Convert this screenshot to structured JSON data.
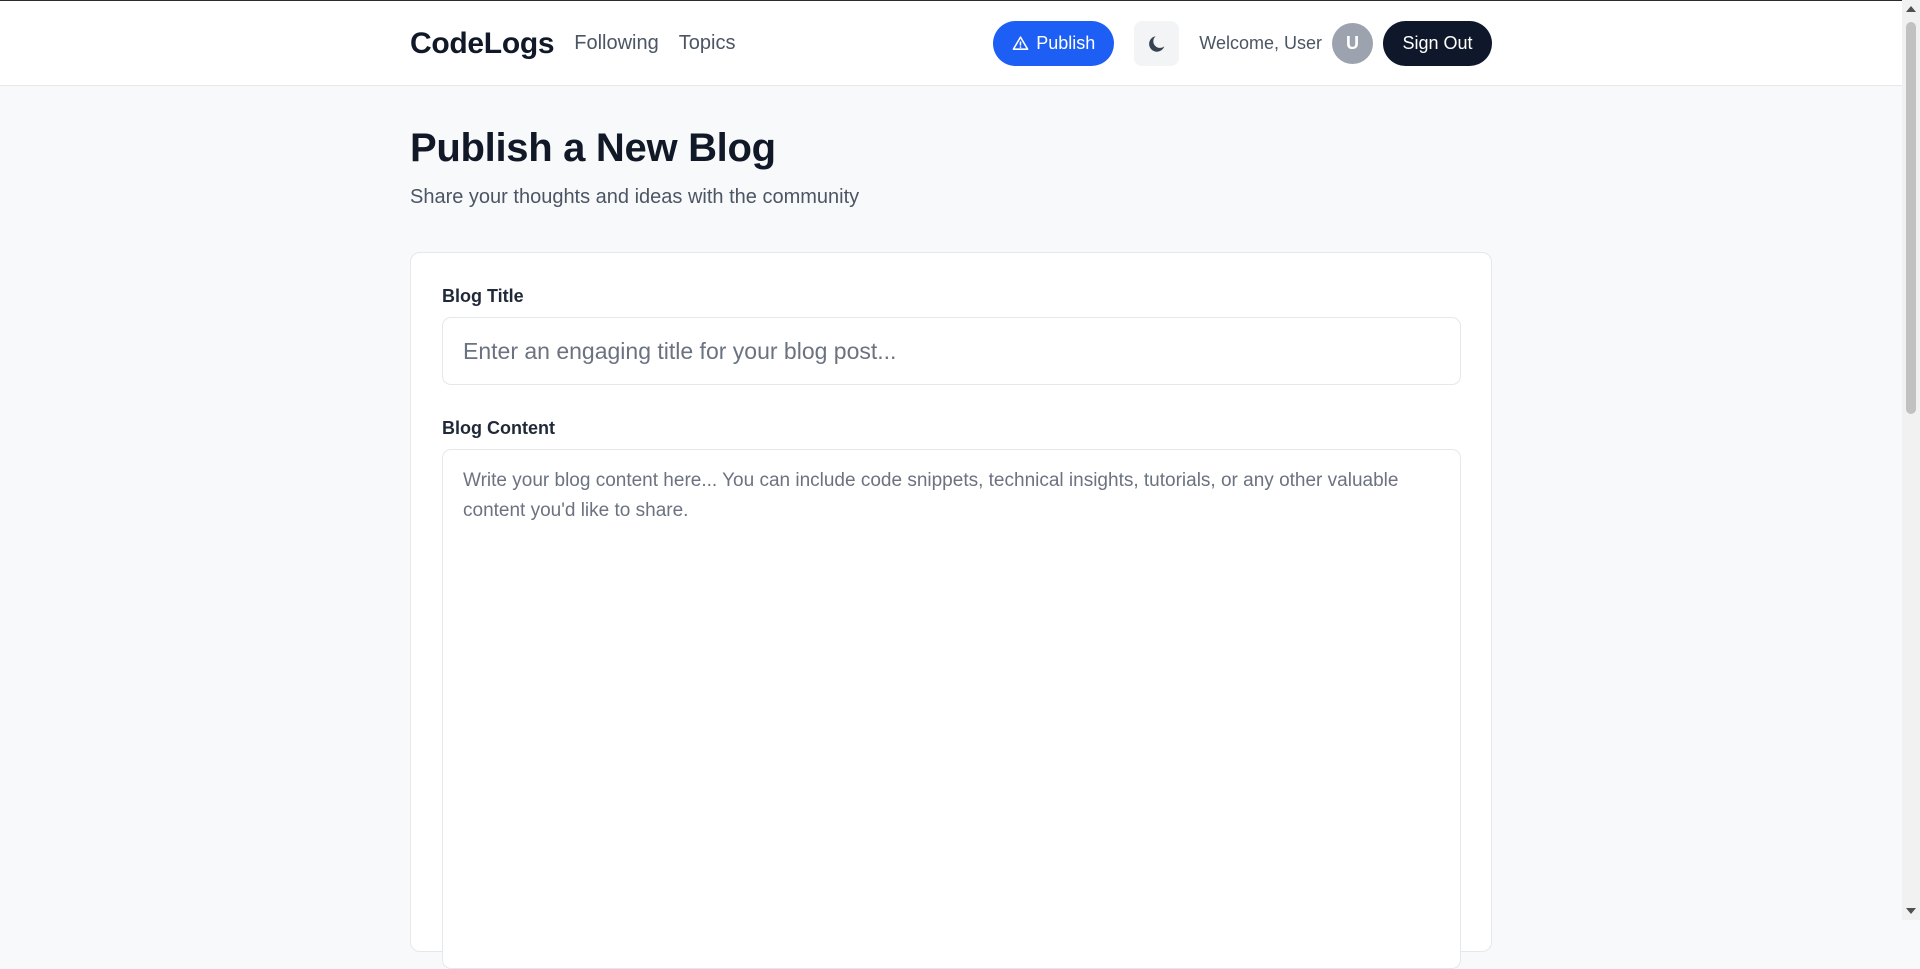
{
  "header": {
    "brand": "CodeLogs",
    "nav": [
      {
        "label": "Following"
      },
      {
        "label": "Topics"
      }
    ],
    "publish_label": "Publish",
    "theme_icon": "moon-icon",
    "welcome_text": "Welcome, User",
    "avatar_initial": "U",
    "signout_label": "Sign Out"
  },
  "page": {
    "title": "Publish a New Blog",
    "subtitle": "Share your thoughts and ideas with the community"
  },
  "form": {
    "title_label": "Blog Title",
    "title_placeholder": "Enter an engaging title for your blog post...",
    "title_value": "",
    "content_label": "Blog Content",
    "content_placeholder": "Write your blog content here... You can include code snippets, technical insights, tutorials, or any other valuable content you'd like to share.",
    "content_value": ""
  },
  "colors": {
    "accent": "#1d5ff5",
    "dark_button": "#0f172a",
    "avatar_bg": "#9ca3af",
    "page_bg": "#f8f9fb"
  }
}
